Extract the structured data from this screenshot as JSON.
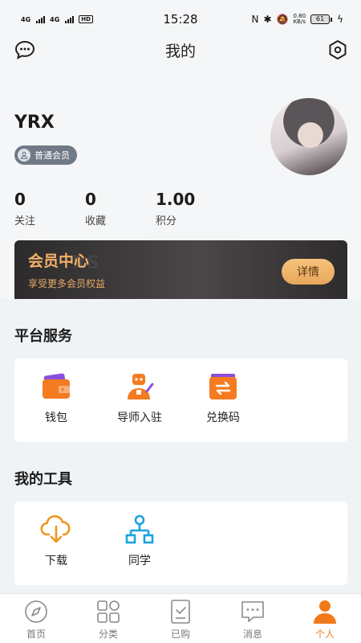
{
  "status_bar": {
    "signal1": "4G",
    "signal2": "4G",
    "hd": "HD",
    "time": "15:28",
    "net_speed": "0.80",
    "net_unit": "KB/s",
    "battery": "61"
  },
  "header": {
    "title": "我的"
  },
  "profile": {
    "username": "YRX",
    "badge": "普通会员"
  },
  "stats": [
    {
      "value": "0",
      "label": "关注"
    },
    {
      "value": "0",
      "label": "收藏"
    },
    {
      "value": "1.00",
      "label": "积分"
    }
  ],
  "vip": {
    "title": "会员中心",
    "watermark": "RS",
    "subtitle": "享受更多会员权益",
    "button": "详情"
  },
  "platform_services": {
    "title": "平台服务",
    "items": [
      {
        "label": "钱包",
        "icon": "wallet-icon"
      },
      {
        "label": "导师入驻",
        "icon": "mentor-robot-icon"
      },
      {
        "label": "兑换码",
        "icon": "exchange-code-icon"
      }
    ]
  },
  "my_tools": {
    "title": "我的工具",
    "items": [
      {
        "label": "下载",
        "icon": "cloud-download-icon"
      },
      {
        "label": "同学",
        "icon": "classmates-tree-icon"
      }
    ]
  },
  "tabbar": {
    "active": 4,
    "items": [
      {
        "label": "首页",
        "icon": "compass-icon"
      },
      {
        "label": "分类",
        "icon": "grid-icon"
      },
      {
        "label": "已购",
        "icon": "purchased-icon"
      },
      {
        "label": "消息",
        "icon": "message-icon"
      },
      {
        "label": "个人",
        "icon": "person-icon"
      }
    ]
  },
  "colors": {
    "accent": "#f07a1a",
    "vip_gold": "#f2b169",
    "tool_blue": "#1aa3e0"
  }
}
